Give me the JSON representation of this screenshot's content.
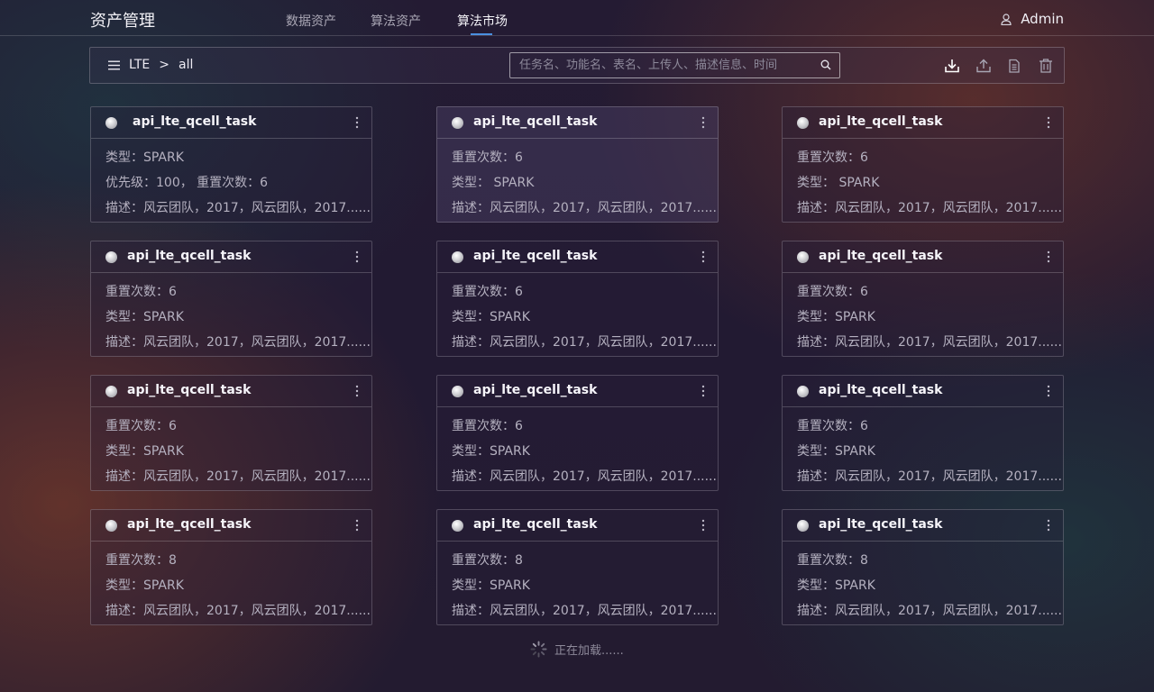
{
  "header": {
    "app_title": "资产管理",
    "tabs": [
      {
        "label": "数据资产",
        "active": false
      },
      {
        "label": "算法资产",
        "active": false
      },
      {
        "label": "算法市场",
        "active": true
      }
    ],
    "user": "Admin",
    "accent_color": "#4a8fe0"
  },
  "toolbar": {
    "breadcrumb": [
      "LTE",
      ">",
      "all"
    ],
    "search_placeholder": "任务名、功能名、表名、上传人、描述信息、时间",
    "icons": [
      "download-icon",
      "upload-icon",
      "document-icon",
      "trash-icon"
    ]
  },
  "cards": [
    {
      "title": "api_lte_qcell_task",
      "lines": [
        "类型：SPARK",
        "优先级：100， 重置次数：6",
        "描述：风云团队，2017，风云团队，2017......"
      ]
    },
    {
      "title": "api_lte_qcell_task",
      "lines": [
        "重置次数：6",
        "类型： SPARK",
        "描述：风云团队，2017，风云团队，2017......"
      ]
    },
    {
      "title": "api_lte_qcell_task",
      "lines": [
        "重置次数：6",
        "类型： SPARK",
        "描述：风云团队，2017，风云团队，2017......"
      ]
    },
    {
      "title": "api_lte_qcell_task",
      "lines": [
        "重置次数：6",
        "类型：SPARK",
        "描述：风云团队，2017，风云团队，2017......"
      ]
    },
    {
      "title": "api_lte_qcell_task",
      "lines": [
        "重置次数：6",
        "类型：SPARK",
        "描述：风云团队，2017，风云团队，2017......"
      ]
    },
    {
      "title": "api_lte_qcell_task",
      "lines": [
        "重置次数：6",
        "类型：SPARK",
        "描述：风云团队，2017，风云团队，2017......"
      ]
    },
    {
      "title": "api_lte_qcell_task",
      "lines": [
        "重置次数：6",
        "类型：SPARK",
        "描述：风云团队，2017，风云团队，2017......"
      ]
    },
    {
      "title": "api_lte_qcell_task",
      "lines": [
        "重置次数：6",
        "类型：SPARK",
        "描述：风云团队，2017，风云团队，2017......"
      ]
    },
    {
      "title": "api_lte_qcell_task",
      "lines": [
        "重置次数：6",
        "类型：SPARK",
        "描述：风云团队，2017，风云团队，2017......"
      ]
    },
    {
      "title": "api_lte_qcell_task",
      "lines": [
        "重置次数：8",
        "类型：SPARK",
        "描述：风云团队，2017，风云团队，2017......"
      ]
    },
    {
      "title": "api_lte_qcell_task",
      "lines": [
        "重置次数：8",
        "类型：SPARK",
        "描述：风云团队，2017，风云团队，2017......"
      ]
    },
    {
      "title": "api_lte_qcell_task",
      "lines": [
        "重置次数：8",
        "类型：SPARK",
        "描述：风云团队，2017，风云团队，2017......"
      ]
    }
  ],
  "loading_text": "正在加载......"
}
